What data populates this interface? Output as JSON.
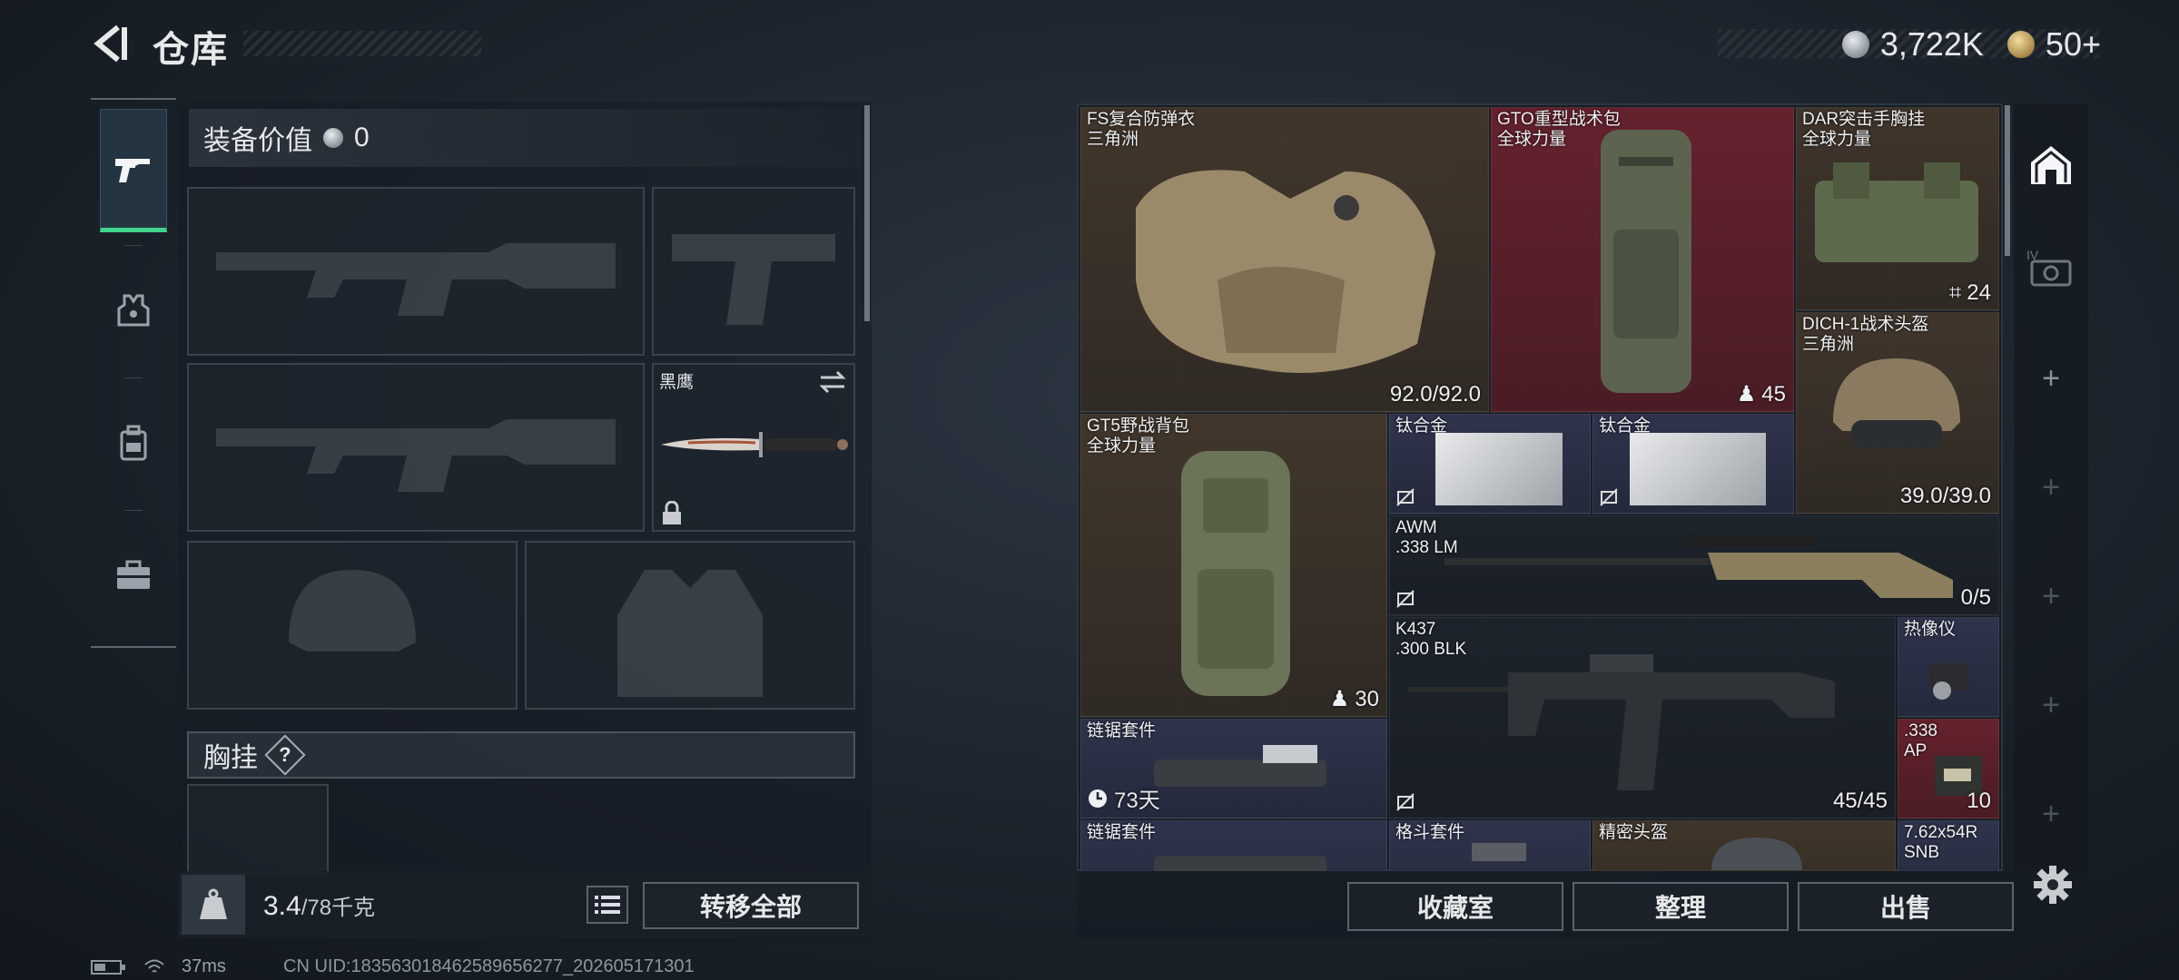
{
  "header": {
    "title": "仓库"
  },
  "currency": {
    "coins": "3,722K",
    "tokens": "50+"
  },
  "loadout": {
    "equip_value_label": "装备价值",
    "equip_value": "0",
    "melee_name": "黑鹰",
    "chest_label": "胸挂",
    "help_mark": "?",
    "weight_value": "3.4",
    "weight_max": "/78千克",
    "transfer_all": "转移全部"
  },
  "stash": {
    "items": [
      {
        "name": "FS复合防弹衣",
        "sub": "三角洲",
        "value": "92.0/92.0",
        "bg": "brown"
      },
      {
        "name": "GTO重型战术包",
        "sub": "全球力量",
        "value": "45",
        "bg": "red"
      },
      {
        "name": "DAR突击手胸挂",
        "sub": "全球力量",
        "value": "24",
        "bg": "brown"
      },
      {
        "name": "DICH-1战术头盔",
        "sub": "三角洲",
        "value": "39.0/39.0",
        "bg": "brown"
      },
      {
        "name": "GT5野战背包",
        "sub": "全球力量",
        "value": "30",
        "bg": "brown"
      },
      {
        "name": "钛合金",
        "sub": "",
        "value": "",
        "bg": "blue"
      },
      {
        "name": "钛合金",
        "sub": "",
        "value": "",
        "bg": "blue"
      },
      {
        "name": "AWM",
        "sub": ".338 LM",
        "value": "0/5",
        "bg": "dark"
      },
      {
        "name": "K437",
        "sub": ".300 BLK",
        "value": "45/45",
        "bg": "dark"
      },
      {
        "name": "热像仪",
        "sub": "",
        "value": "",
        "bg": "blue"
      },
      {
        "name": ".338",
        "sub": "AP",
        "value": "10",
        "bg": "red"
      },
      {
        "name": "链锯套件",
        "sub": "",
        "value": "73天",
        "bg": "blue"
      },
      {
        "name": "链锯套件",
        "sub": "",
        "value": "",
        "bg": "blue"
      },
      {
        "name": "格斗套件",
        "sub": "",
        "value": "",
        "bg": "blue"
      },
      {
        "name": "精密头盔",
        "sub": "",
        "value": "",
        "bg": "brown"
      },
      {
        "name": "7.62x54R",
        "sub": "SNB",
        "value": "",
        "bg": "blue"
      }
    ]
  },
  "actions": {
    "collection": "收藏室",
    "organize": "整理",
    "sell": "出售"
  },
  "status": {
    "ping": "37ms",
    "uid": "CN UID:18356301846258965​6277_202605171301"
  },
  "colors": {
    "accent_green": "#3fd68c",
    "rarity_red": "#6e222e",
    "rarity_blue": "#323650",
    "rarity_brown": "#483a2c"
  },
  "icons": [
    "back-arrow-icon",
    "coin-icon",
    "token-icon",
    "gun-icon",
    "armor-icon",
    "backpack-icon",
    "toolbox-icon",
    "hideout-icon",
    "camera-icon",
    "plus-icon",
    "settings-icon",
    "lock-icon",
    "swap-icon",
    "weight-icon",
    "list-icon",
    "timer-icon",
    "no-insure-icon"
  ]
}
